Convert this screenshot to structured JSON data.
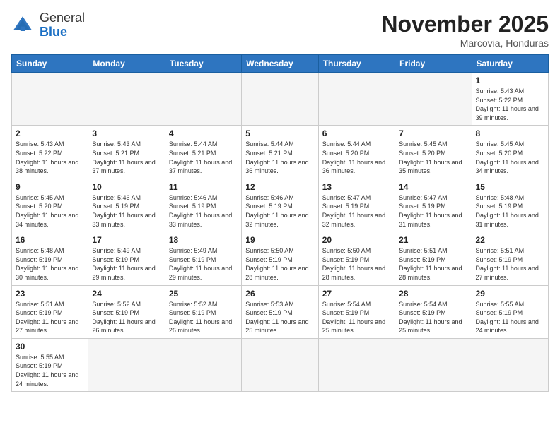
{
  "header": {
    "logo_general": "General",
    "logo_blue": "Blue",
    "title": "November 2025",
    "location": "Marcovia, Honduras"
  },
  "days_of_week": [
    "Sunday",
    "Monday",
    "Tuesday",
    "Wednesday",
    "Thursday",
    "Friday",
    "Saturday"
  ],
  "weeks": [
    [
      {
        "day": "",
        "empty": true
      },
      {
        "day": "",
        "empty": true
      },
      {
        "day": "",
        "empty": true
      },
      {
        "day": "",
        "empty": true
      },
      {
        "day": "",
        "empty": true
      },
      {
        "day": "",
        "empty": true
      },
      {
        "day": "1",
        "sunrise": "Sunrise: 5:43 AM",
        "sunset": "Sunset: 5:22 PM",
        "daylight": "Daylight: 11 hours and 39 minutes."
      }
    ],
    [
      {
        "day": "2",
        "sunrise": "Sunrise: 5:43 AM",
        "sunset": "Sunset: 5:22 PM",
        "daylight": "Daylight: 11 hours and 38 minutes."
      },
      {
        "day": "3",
        "sunrise": "Sunrise: 5:43 AM",
        "sunset": "Sunset: 5:21 PM",
        "daylight": "Daylight: 11 hours and 37 minutes."
      },
      {
        "day": "4",
        "sunrise": "Sunrise: 5:44 AM",
        "sunset": "Sunset: 5:21 PM",
        "daylight": "Daylight: 11 hours and 37 minutes."
      },
      {
        "day": "5",
        "sunrise": "Sunrise: 5:44 AM",
        "sunset": "Sunset: 5:21 PM",
        "daylight": "Daylight: 11 hours and 36 minutes."
      },
      {
        "day": "6",
        "sunrise": "Sunrise: 5:44 AM",
        "sunset": "Sunset: 5:20 PM",
        "daylight": "Daylight: 11 hours and 36 minutes."
      },
      {
        "day": "7",
        "sunrise": "Sunrise: 5:45 AM",
        "sunset": "Sunset: 5:20 PM",
        "daylight": "Daylight: 11 hours and 35 minutes."
      },
      {
        "day": "8",
        "sunrise": "Sunrise: 5:45 AM",
        "sunset": "Sunset: 5:20 PM",
        "daylight": "Daylight: 11 hours and 34 minutes."
      }
    ],
    [
      {
        "day": "9",
        "sunrise": "Sunrise: 5:45 AM",
        "sunset": "Sunset: 5:20 PM",
        "daylight": "Daylight: 11 hours and 34 minutes."
      },
      {
        "day": "10",
        "sunrise": "Sunrise: 5:46 AM",
        "sunset": "Sunset: 5:19 PM",
        "daylight": "Daylight: 11 hours and 33 minutes."
      },
      {
        "day": "11",
        "sunrise": "Sunrise: 5:46 AM",
        "sunset": "Sunset: 5:19 PM",
        "daylight": "Daylight: 11 hours and 33 minutes."
      },
      {
        "day": "12",
        "sunrise": "Sunrise: 5:46 AM",
        "sunset": "Sunset: 5:19 PM",
        "daylight": "Daylight: 11 hours and 32 minutes."
      },
      {
        "day": "13",
        "sunrise": "Sunrise: 5:47 AM",
        "sunset": "Sunset: 5:19 PM",
        "daylight": "Daylight: 11 hours and 32 minutes."
      },
      {
        "day": "14",
        "sunrise": "Sunrise: 5:47 AM",
        "sunset": "Sunset: 5:19 PM",
        "daylight": "Daylight: 11 hours and 31 minutes."
      },
      {
        "day": "15",
        "sunrise": "Sunrise: 5:48 AM",
        "sunset": "Sunset: 5:19 PM",
        "daylight": "Daylight: 11 hours and 31 minutes."
      }
    ],
    [
      {
        "day": "16",
        "sunrise": "Sunrise: 5:48 AM",
        "sunset": "Sunset: 5:19 PM",
        "daylight": "Daylight: 11 hours and 30 minutes."
      },
      {
        "day": "17",
        "sunrise": "Sunrise: 5:49 AM",
        "sunset": "Sunset: 5:19 PM",
        "daylight": "Daylight: 11 hours and 29 minutes."
      },
      {
        "day": "18",
        "sunrise": "Sunrise: 5:49 AM",
        "sunset": "Sunset: 5:19 PM",
        "daylight": "Daylight: 11 hours and 29 minutes."
      },
      {
        "day": "19",
        "sunrise": "Sunrise: 5:50 AM",
        "sunset": "Sunset: 5:19 PM",
        "daylight": "Daylight: 11 hours and 28 minutes."
      },
      {
        "day": "20",
        "sunrise": "Sunrise: 5:50 AM",
        "sunset": "Sunset: 5:19 PM",
        "daylight": "Daylight: 11 hours and 28 minutes."
      },
      {
        "day": "21",
        "sunrise": "Sunrise: 5:51 AM",
        "sunset": "Sunset: 5:19 PM",
        "daylight": "Daylight: 11 hours and 28 minutes."
      },
      {
        "day": "22",
        "sunrise": "Sunrise: 5:51 AM",
        "sunset": "Sunset: 5:19 PM",
        "daylight": "Daylight: 11 hours and 27 minutes."
      }
    ],
    [
      {
        "day": "23",
        "sunrise": "Sunrise: 5:51 AM",
        "sunset": "Sunset: 5:19 PM",
        "daylight": "Daylight: 11 hours and 27 minutes."
      },
      {
        "day": "24",
        "sunrise": "Sunrise: 5:52 AM",
        "sunset": "Sunset: 5:19 PM",
        "daylight": "Daylight: 11 hours and 26 minutes."
      },
      {
        "day": "25",
        "sunrise": "Sunrise: 5:52 AM",
        "sunset": "Sunset: 5:19 PM",
        "daylight": "Daylight: 11 hours and 26 minutes."
      },
      {
        "day": "26",
        "sunrise": "Sunrise: 5:53 AM",
        "sunset": "Sunset: 5:19 PM",
        "daylight": "Daylight: 11 hours and 25 minutes."
      },
      {
        "day": "27",
        "sunrise": "Sunrise: 5:54 AM",
        "sunset": "Sunset: 5:19 PM",
        "daylight": "Daylight: 11 hours and 25 minutes."
      },
      {
        "day": "28",
        "sunrise": "Sunrise: 5:54 AM",
        "sunset": "Sunset: 5:19 PM",
        "daylight": "Daylight: 11 hours and 25 minutes."
      },
      {
        "day": "29",
        "sunrise": "Sunrise: 5:55 AM",
        "sunset": "Sunset: 5:19 PM",
        "daylight": "Daylight: 11 hours and 24 minutes."
      }
    ],
    [
      {
        "day": "30",
        "sunrise": "Sunrise: 5:55 AM",
        "sunset": "Sunset: 5:19 PM",
        "daylight": "Daylight: 11 hours and 24 minutes."
      },
      {
        "day": "",
        "empty": true
      },
      {
        "day": "",
        "empty": true
      },
      {
        "day": "",
        "empty": true
      },
      {
        "day": "",
        "empty": true
      },
      {
        "day": "",
        "empty": true
      },
      {
        "day": "",
        "empty": true
      }
    ]
  ]
}
